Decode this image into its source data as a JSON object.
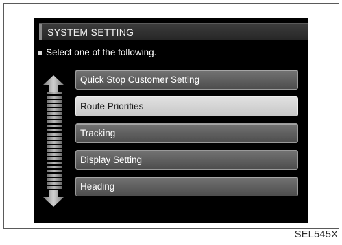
{
  "screen": {
    "title": "SYSTEM SETTING",
    "instruction": "Select one of the following.",
    "menu_items": [
      {
        "label": "Quick Stop Customer Setting",
        "selected": false
      },
      {
        "label": "Route Priorities",
        "selected": true
      },
      {
        "label": "Tracking",
        "selected": false
      },
      {
        "label": "Display Setting",
        "selected": false
      },
      {
        "label": "Heading",
        "selected": false
      }
    ]
  },
  "caption": "SEL545X"
}
